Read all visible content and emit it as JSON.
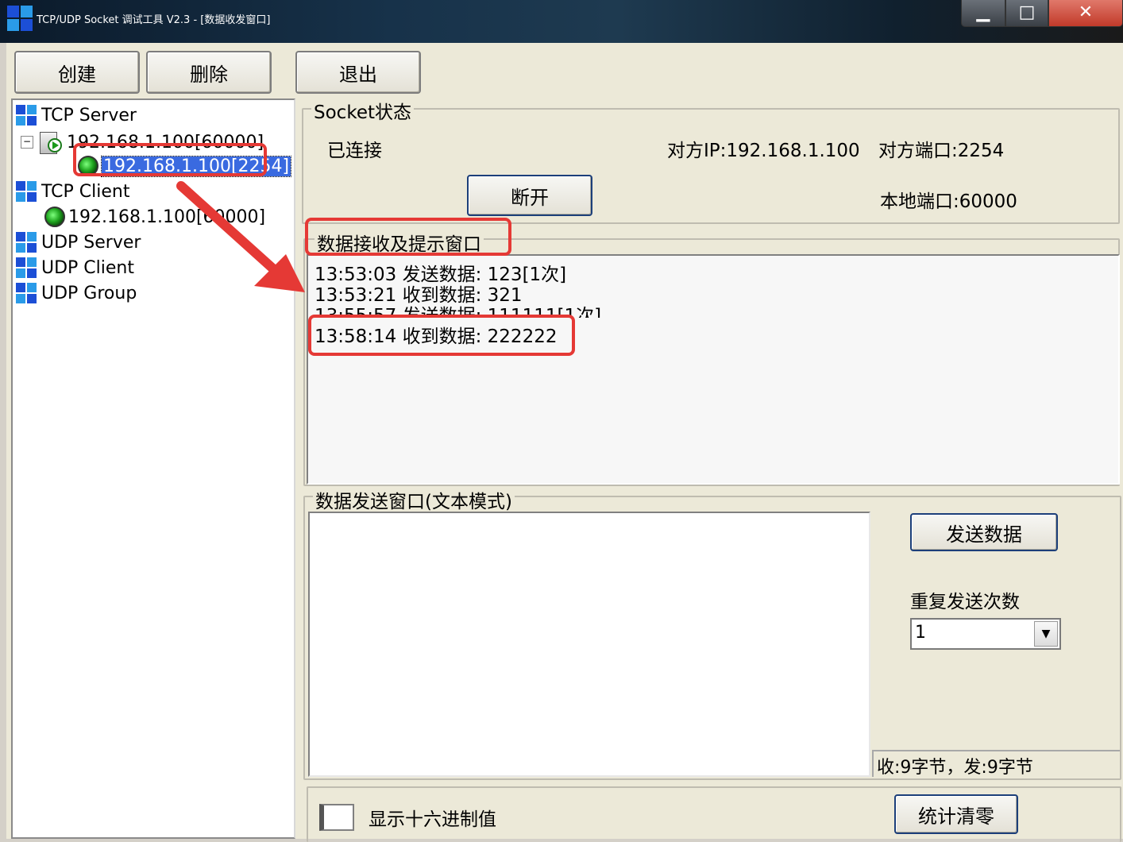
{
  "window": {
    "title": "TCP/UDP Socket 调试工具 V2.3 - [数据收发窗口]",
    "minimize_glyph": "▁",
    "maximize_glyph": "□",
    "close_glyph": "✕"
  },
  "toolbar": {
    "create_label": "创建",
    "delete_label": "删除",
    "exit_label": "退出"
  },
  "tree": {
    "tcp_server": "TCP Server",
    "tcp_server_listener": "192.168.1.100[60000]",
    "tcp_server_connection": "192.168.1.100[2254]",
    "tcp_client": "TCP Client",
    "tcp_client_connection": "192.168.1.100[60000]",
    "udp_server": "UDP Server",
    "udp_client": "UDP Client",
    "udp_group": "UDP Group"
  },
  "socket_status": {
    "legend": "Socket状态",
    "state": "已连接",
    "remote_ip": "对方IP:192.168.1.100",
    "remote_port": "对方端口:2254",
    "local_port": "本地端口:60000",
    "disconnect_label": "断开"
  },
  "receive": {
    "legend": "数据接收及提示窗口",
    "lines": [
      "13:53:03 发送数据: 123[1次]",
      "13:53:21 收到数据: 321",
      "13:55:57 发送数据: 111111[1次]",
      "13:58:14 收到数据: 222222"
    ]
  },
  "send": {
    "legend": "数据发送窗口(文本模式)",
    "text_value": "",
    "send_label": "发送数据",
    "repeat_label": "重复发送次数",
    "repeat_value": "1",
    "stats": "收:9字节，发:9字节",
    "hex_label": "显示十六进制值",
    "clear_stats_label": "统计清零"
  },
  "colors": {
    "annotation": "#e53935",
    "selection": "#3a6ae0",
    "logo": [
      "#1c4fd6",
      "#2a7de0",
      "#1c4fd6",
      "#2a7de0"
    ]
  }
}
